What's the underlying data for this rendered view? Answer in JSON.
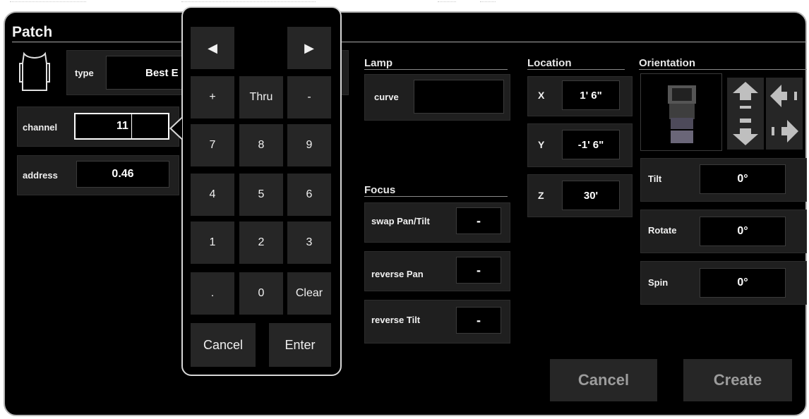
{
  "window": {
    "title": "Patch"
  },
  "fixture": {
    "type_label": "type",
    "type_value": "Best E",
    "channel_label": "channel",
    "channel_value": "11",
    "address_label": "address",
    "address_value": "0.46"
  },
  "keypad": {
    "prev_arrow": "◀",
    "next_arrow": "▶",
    "keys": [
      [
        "+",
        "Thru",
        "-"
      ],
      [
        "7",
        "8",
        "9"
      ],
      [
        "4",
        "5",
        "6"
      ],
      [
        "1",
        "2",
        "3"
      ],
      [
        ".",
        "0",
        "Clear"
      ]
    ],
    "cancel_label": "Cancel",
    "enter_label": "Enter"
  },
  "lamp": {
    "heading": "Lamp",
    "curve_label": "curve",
    "curve_value": ""
  },
  "focus": {
    "heading": "Focus",
    "swap_label": "swap Pan/Tilt",
    "swap_value": "-",
    "reverse_pan_label": "reverse Pan",
    "reverse_pan_value": "-",
    "reverse_tilt_label": "reverse Tilt",
    "reverse_tilt_value": "-"
  },
  "location": {
    "heading": "Location",
    "x_label": "X",
    "x_value": "1' 6\"",
    "y_label": "Y",
    "y_value": "-1' 6\"",
    "z_label": "Z",
    "z_value": "30'"
  },
  "orientation": {
    "heading": "Orientation",
    "tilt_label": "Tilt",
    "tilt_value": "0°",
    "rotate_label": "Rotate",
    "rotate_value": "0°",
    "spin_label": "Spin",
    "spin_value": "0°"
  },
  "actions": {
    "cancel_label": "Cancel",
    "create_label": "Create"
  },
  "colors": {
    "background": "#000000",
    "panel": "#1f1f1f",
    "button": "#262626",
    "border": "#b5b5b5"
  }
}
